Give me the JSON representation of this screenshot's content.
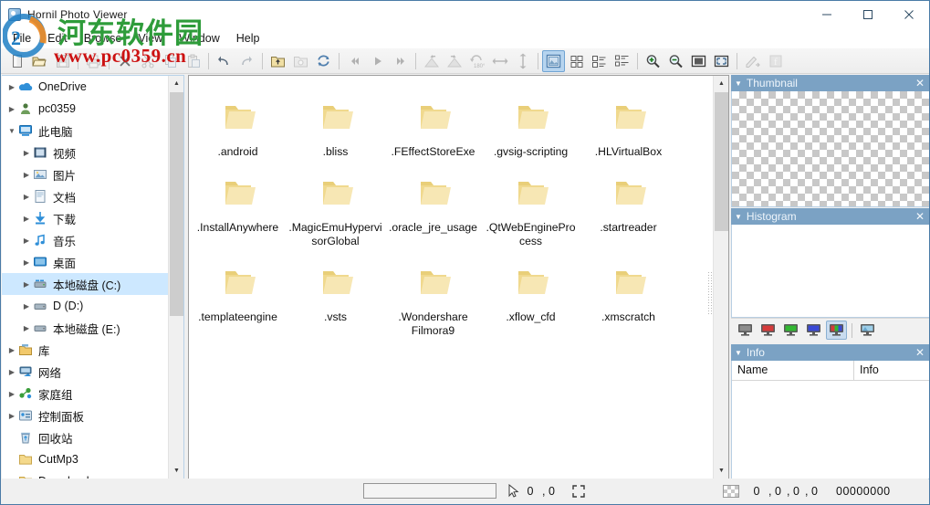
{
  "window": {
    "title": "Hornil Photo Viewer",
    "app_icon": "photo-viewer-icon",
    "minimize": "minimize-icon",
    "maximize": "maximize-icon",
    "close": "close-icon"
  },
  "watermark": {
    "chinese": "河东软件园",
    "url": "www.pc0359.cn",
    "green": "#2e9c3a",
    "red": "#cc1111"
  },
  "menubar": {
    "items": [
      {
        "label": "File"
      },
      {
        "label": "Edit"
      },
      {
        "label": "Browse"
      },
      {
        "label": "View"
      },
      {
        "label": "Window"
      },
      {
        "label": "Help"
      }
    ]
  },
  "toolbar": {
    "items": [
      {
        "name": "new-icon",
        "enabled": true,
        "active": false
      },
      {
        "name": "open-folder-icon",
        "enabled": true,
        "active": false
      },
      {
        "name": "save-icon",
        "enabled": false,
        "active": false
      },
      {
        "name": "separator"
      },
      {
        "name": "print-icon",
        "enabled": false,
        "active": false
      },
      {
        "name": "separator"
      },
      {
        "name": "delete-icon",
        "enabled": true,
        "active": false
      },
      {
        "name": "cut-icon",
        "enabled": false,
        "active": false
      },
      {
        "name": "copy-icon",
        "enabled": false,
        "active": false
      },
      {
        "name": "paste-icon",
        "enabled": false,
        "active": false
      },
      {
        "name": "separator"
      },
      {
        "name": "undo-icon",
        "enabled": true,
        "active": false
      },
      {
        "name": "redo-icon",
        "enabled": false,
        "active": false
      },
      {
        "name": "separator"
      },
      {
        "name": "parent-folder-icon",
        "enabled": true,
        "active": false
      },
      {
        "name": "refresh-folder-icon",
        "enabled": false,
        "active": false
      },
      {
        "name": "reload-icon",
        "enabled": true,
        "active": false
      },
      {
        "name": "separator"
      },
      {
        "name": "first-image-icon",
        "enabled": false,
        "active": false
      },
      {
        "name": "next-image-icon",
        "enabled": false,
        "active": false
      },
      {
        "name": "last-image-icon",
        "enabled": false,
        "active": false
      },
      {
        "name": "separator"
      },
      {
        "name": "rotate-left-icon",
        "enabled": false,
        "active": false
      },
      {
        "name": "rotate-right-icon",
        "enabled": false,
        "active": false
      },
      {
        "name": "rotate-180-icon",
        "enabled": false,
        "active": false
      },
      {
        "name": "flip-horizontal-icon",
        "enabled": false,
        "active": false
      },
      {
        "name": "flip-vertical-icon",
        "enabled": false,
        "active": false
      },
      {
        "name": "separator"
      },
      {
        "name": "view-thumbnails-icon",
        "enabled": true,
        "active": true
      },
      {
        "name": "view-tiles-icon",
        "enabled": true,
        "active": false
      },
      {
        "name": "view-list-icon",
        "enabled": true,
        "active": false
      },
      {
        "name": "view-details-icon",
        "enabled": true,
        "active": false
      },
      {
        "name": "separator"
      },
      {
        "name": "zoom-in-icon",
        "enabled": true,
        "active": false
      },
      {
        "name": "zoom-out-icon",
        "enabled": true,
        "active": false
      },
      {
        "name": "actual-size-icon",
        "enabled": true,
        "active": false
      },
      {
        "name": "fit-to-window-icon",
        "enabled": true,
        "active": false
      },
      {
        "name": "separator"
      },
      {
        "name": "edit-image-icon",
        "enabled": false,
        "active": false
      },
      {
        "name": "facebook-share-icon",
        "enabled": false,
        "active": false
      }
    ]
  },
  "tree": {
    "items": [
      {
        "label": "OneDrive",
        "icon": "onedrive-icon",
        "indent": 0,
        "expander": "collapsed",
        "selected": false
      },
      {
        "label": "pc0359",
        "icon": "user-icon",
        "indent": 0,
        "expander": "collapsed",
        "selected": false
      },
      {
        "label": "此电脑",
        "icon": "this-pc-icon",
        "indent": 0,
        "expander": "expanded",
        "selected": false
      },
      {
        "label": "视频",
        "icon": "videos-icon",
        "indent": 1,
        "expander": "collapsed",
        "selected": false
      },
      {
        "label": "图片",
        "icon": "pictures-icon",
        "indent": 1,
        "expander": "collapsed",
        "selected": false
      },
      {
        "label": "文档",
        "icon": "documents-icon",
        "indent": 1,
        "expander": "collapsed",
        "selected": false
      },
      {
        "label": "下载",
        "icon": "downloads-icon",
        "indent": 1,
        "expander": "collapsed",
        "selected": false
      },
      {
        "label": "音乐",
        "icon": "music-icon",
        "indent": 1,
        "expander": "collapsed",
        "selected": false
      },
      {
        "label": "桌面",
        "icon": "desktop-icon",
        "indent": 1,
        "expander": "collapsed",
        "selected": false
      },
      {
        "label": "本地磁盘 (C:)",
        "icon": "system-drive-icon",
        "indent": 1,
        "expander": "collapsed",
        "selected": true
      },
      {
        "label": "D (D:)",
        "icon": "drive-icon",
        "indent": 1,
        "expander": "collapsed",
        "selected": false
      },
      {
        "label": "本地磁盘 (E:)",
        "icon": "drive-icon",
        "indent": 1,
        "expander": "collapsed",
        "selected": false
      },
      {
        "label": "库",
        "icon": "library-icon",
        "indent": 0,
        "expander": "collapsed",
        "selected": false
      },
      {
        "label": "网络",
        "icon": "network-icon",
        "indent": 0,
        "expander": "collapsed",
        "selected": false
      },
      {
        "label": "家庭组",
        "icon": "homegroup-icon",
        "indent": 0,
        "expander": "collapsed",
        "selected": false
      },
      {
        "label": "控制面板",
        "icon": "control-panel-icon",
        "indent": 0,
        "expander": "collapsed",
        "selected": false
      },
      {
        "label": "回收站",
        "icon": "recycle-bin-icon",
        "indent": 0,
        "expander": "none",
        "selected": false
      },
      {
        "label": "CutMp3",
        "icon": "folder-icon",
        "indent": 0,
        "expander": "none",
        "selected": false
      },
      {
        "label": "Downloads",
        "icon": "folder-icon",
        "indent": 0,
        "expander": "none",
        "selected": false
      }
    ]
  },
  "browser": {
    "rows": [
      [
        {
          "label": ".android",
          "icon": "folder-icon"
        },
        {
          "label": ".bliss",
          "icon": "folder-icon"
        },
        {
          "label": ".FEffectStoreExe",
          "icon": "folder-icon"
        },
        {
          "label": ".gvsig-scripting",
          "icon": "folder-icon"
        },
        {
          "label": ".HLVirtualBox",
          "icon": "folder-icon"
        }
      ],
      [
        {
          "label": ".InstallAnywhere",
          "icon": "folder-icon"
        },
        {
          "label": ".MagicEmuHypervisorGlobal",
          "icon": "folder-icon"
        },
        {
          "label": ".oracle_jre_usage",
          "icon": "folder-icon"
        },
        {
          "label": ".QtWebEngineProcess",
          "icon": "folder-icon"
        },
        {
          "label": ".startreader",
          "icon": "folder-icon"
        }
      ],
      [
        {
          "label": ".templateengine",
          "icon": "folder-icon"
        },
        {
          "label": ".vsts",
          "icon": "folder-icon"
        },
        {
          "label": ".Wondershare Filmora9",
          "icon": "folder-icon"
        },
        {
          "label": ".xflow_cfd",
          "icon": "folder-icon"
        },
        {
          "label": ".xmscratch",
          "icon": "folder-icon"
        }
      ]
    ]
  },
  "panels": {
    "thumbnail": {
      "title": "Thumbnail",
      "collapse": "collapse-caret-icon",
      "close": "close-icon"
    },
    "histogram": {
      "title": "Histogram",
      "collapse": "collapse-caret-icon",
      "close": "close-icon",
      "channels": [
        {
          "name": "histogram-channel-luminance",
          "active": false
        },
        {
          "name": "histogram-channel-red",
          "active": false
        },
        {
          "name": "histogram-channel-green",
          "active": false
        },
        {
          "name": "histogram-channel-blue",
          "active": false
        },
        {
          "name": "histogram-channel-rgb",
          "active": true
        },
        {
          "name": "histogram-channel-alpha",
          "active": false
        }
      ]
    },
    "info": {
      "title": "Info",
      "collapse": "collapse-caret-icon",
      "close": "close-icon",
      "columns": [
        "Name",
        "Info"
      ],
      "rows": []
    }
  },
  "statusbar": {
    "path_value": "",
    "path_placeholder": "",
    "cursor_icon": "cursor-arrow-icon",
    "cursor_x": "0",
    "cursor_sep": ", 0",
    "fit_icon": "fit-screen-icon",
    "color_swatch": "transparent-swatch",
    "rgba": [
      "0",
      ", 0",
      ", 0",
      ", 0"
    ],
    "hex": "00000000"
  }
}
